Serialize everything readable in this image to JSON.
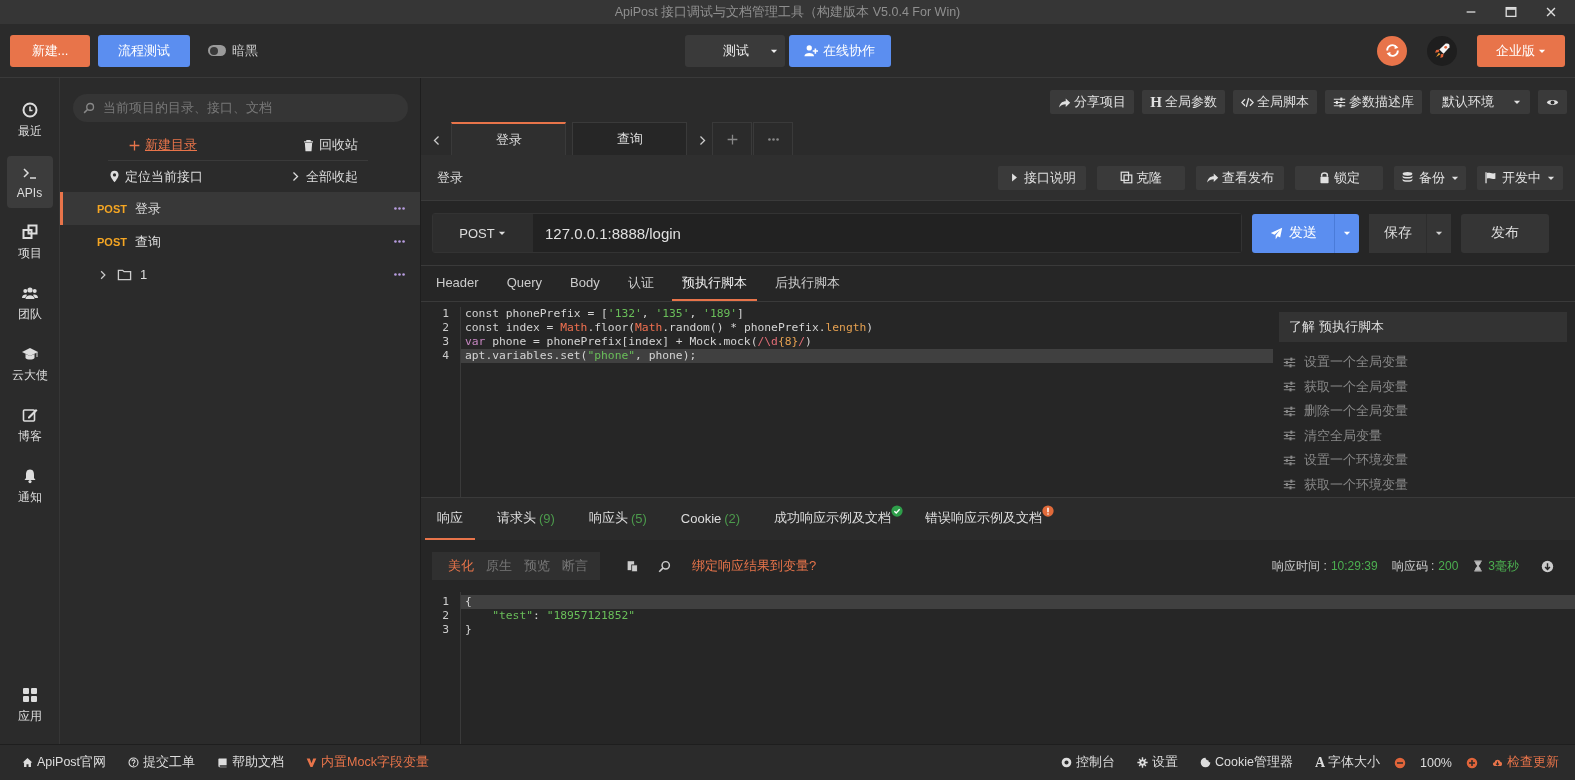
{
  "window": {
    "title": "ApiPost 接口调试与文档管理工具（构建版本 V5.0.4 For Win)"
  },
  "toolbar": {
    "new_button": "新建...",
    "flow_button": "流程测试",
    "dark_toggle": {
      "label": "暗黑",
      "on": false
    },
    "environment": "测试",
    "collab_button": "在线协作",
    "edition_button": "企业版"
  },
  "nav_rail": [
    {
      "label": "最近",
      "selected": false
    },
    {
      "label": "APIs",
      "selected": true
    },
    {
      "label": "项目",
      "selected": false
    },
    {
      "label": "团队",
      "selected": false
    },
    {
      "label": "云大使",
      "selected": false
    },
    {
      "label": "博客",
      "selected": false
    },
    {
      "label": "通知",
      "selected": false
    },
    {
      "label": "应用",
      "selected": false
    }
  ],
  "sidebar": {
    "search": {
      "placeholder": "当前项目的目录、接口、文档"
    },
    "new_folder": "新建目录",
    "recycle_bin": "回收站",
    "locate": "定位当前接口",
    "collapse_all": "全部收起",
    "tree": [
      {
        "kind": "api",
        "method": "POST",
        "name": "登录",
        "selected": true
      },
      {
        "kind": "api",
        "method": "POST",
        "name": "查询",
        "selected": false
      },
      {
        "kind": "folder",
        "name": "1",
        "expanded": false,
        "selected": false
      }
    ]
  },
  "global_actions": [
    {
      "label": "分享项目"
    },
    {
      "glyph": "H",
      "label": "全局参数"
    },
    {
      "label": "全局脚本"
    },
    {
      "label": "参数描述库"
    }
  ],
  "environment_select": "默认环境",
  "request_tabs": [
    {
      "label": "登录",
      "selected": true
    },
    {
      "label": "查询",
      "selected": false
    }
  ],
  "request": {
    "title": "登录",
    "actions": [
      "接口说明",
      "克隆",
      "查看发布",
      "锁定"
    ],
    "backup": "备份",
    "status": "开发中",
    "method": "POST",
    "url": "127.0.0.1:8888/login",
    "send": "发送",
    "save": "保存",
    "publish": "发布"
  },
  "editor_tabs": [
    {
      "label": "Header",
      "selected": false
    },
    {
      "label": "Query",
      "selected": false
    },
    {
      "label": "Body",
      "selected": false
    },
    {
      "label": "认证",
      "selected": false
    },
    {
      "label": "预执行脚本",
      "selected": true
    },
    {
      "label": "后执行脚本",
      "selected": false
    }
  ],
  "script": {
    "lines": [
      {
        "number": "1",
        "active": false,
        "tokens": [
          {
            "kind": "plain",
            "text": "const phonePrefix = ["
          },
          {
            "kind": "string",
            "text": "'132'"
          },
          {
            "kind": "plain",
            "text": ", "
          },
          {
            "kind": "string",
            "text": "'135'"
          },
          {
            "kind": "plain",
            "text": ", "
          },
          {
            "kind": "string",
            "text": "'189'"
          },
          {
            "kind": "plain",
            "text": "]"
          }
        ]
      },
      {
        "number": "2",
        "active": false,
        "tokens": [
          {
            "kind": "plain",
            "text": "const index = "
          },
          {
            "kind": "builtin",
            "text": "Math"
          },
          {
            "kind": "plain",
            "text": ".floor("
          },
          {
            "kind": "builtin",
            "text": "Math"
          },
          {
            "kind": "plain",
            "text": ".random() * phonePrefix."
          },
          {
            "kind": "property",
            "text": "length"
          },
          {
            "kind": "plain",
            "text": ")"
          }
        ]
      },
      {
        "number": "3",
        "active": false,
        "tokens": [
          {
            "kind": "keyword",
            "text": "var"
          },
          {
            "kind": "plain",
            "text": " phone = phonePrefix[index] + Mock.mock("
          },
          {
            "kind": "regex",
            "text": "/\\d"
          },
          {
            "kind": "property",
            "text": "{8}"
          },
          {
            "kind": "regex",
            "text": "/"
          },
          {
            "kind": "plain",
            "text": ")"
          }
        ]
      },
      {
        "number": "4",
        "active": true,
        "tokens": [
          {
            "kind": "plain",
            "text": "apt.variables.set("
          },
          {
            "kind": "string",
            "text": "\"phone\""
          },
          {
            "kind": "plain",
            "text": ", phone);"
          }
        ]
      }
    ]
  },
  "help": {
    "title": "了解 预执行脚本",
    "items": [
      "设置一个全局变量",
      "获取一个全局变量",
      "删除一个全局变量",
      "清空全局变量",
      "设置一个环境变量",
      "获取一个环境变量"
    ]
  },
  "response": {
    "tabs": [
      {
        "label": "响应",
        "selected": true
      },
      {
        "label": "请求头",
        "count": "(9)",
        "selected": false
      },
      {
        "label": "响应头",
        "count": "(5)",
        "selected": false
      },
      {
        "label": "Cookie",
        "count": "(2)",
        "selected": false
      },
      {
        "label": "成功响应示例及文档",
        "kind": "success",
        "selected": false
      },
      {
        "label": "错误响应示例及文档",
        "kind": "error",
        "selected": false
      }
    ],
    "views": [
      {
        "label": "美化",
        "selected": true
      },
      {
        "label": "原生",
        "selected": false
      },
      {
        "label": "预览",
        "selected": false
      },
      {
        "label": "断言",
        "selected": false
      }
    ],
    "bind_link": "绑定响应结果到变量?",
    "time_label": "响应时间 :",
    "time": "10:29:39",
    "code_label": "响应码 :",
    "code": "200",
    "duration": "3毫秒",
    "lines": [
      {
        "number": "1",
        "active": true,
        "tokens": [
          {
            "kind": "plain",
            "text": "{"
          }
        ]
      },
      {
        "number": "2",
        "active": false,
        "tokens": [
          {
            "kind": "string",
            "text": "    \"test\""
          },
          {
            "kind": "plain",
            "text": ": "
          },
          {
            "kind": "string",
            "text": "\"18957121852\""
          }
        ]
      },
      {
        "number": "3",
        "active": false,
        "tokens": [
          {
            "kind": "plain",
            "text": "}"
          }
        ]
      }
    ]
  },
  "status_bar": {
    "left": [
      {
        "label": "ApiPost官网",
        "highlight": false
      },
      {
        "label": "提交工单",
        "highlight": false
      },
      {
        "label": "帮助文档",
        "highlight": false
      },
      {
        "label": "内置Mock字段变量",
        "highlight": true
      }
    ],
    "console": "控制台",
    "settings": "设置",
    "cookie_manager": "Cookie管理器",
    "font_glyph": "A",
    "font_size_label": "字体大小",
    "zoom": "100%",
    "update": "检查更新"
  }
}
